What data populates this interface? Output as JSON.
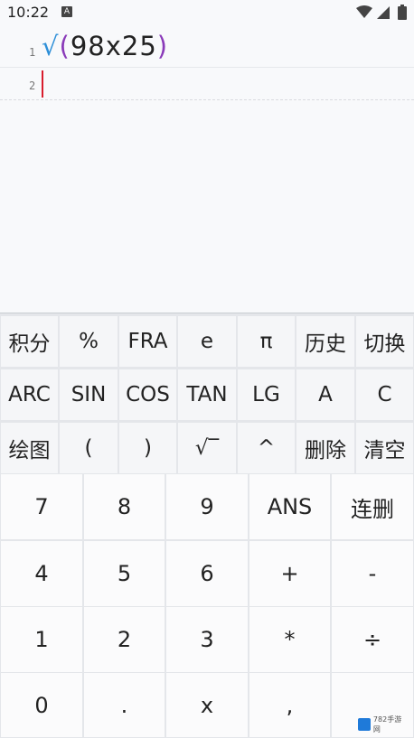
{
  "status_bar": {
    "time": "10:22",
    "notification_icon": "A",
    "icons": [
      "wifi-icon",
      "signal-icon",
      "battery-icon"
    ]
  },
  "editor": {
    "lines": [
      {
        "number": "1",
        "tokens": {
          "sqrt": "√",
          "open": "(",
          "body": "98x25",
          "close": ")"
        }
      },
      {
        "number": "2",
        "tokens": {}
      }
    ],
    "colors": {
      "sqrt": "#2d8fd8",
      "paren": "#8a3ab9",
      "cursor": "#d81c2c"
    }
  },
  "function_keys": [
    [
      "积分",
      "%",
      "FRA",
      "e",
      "π",
      "历史",
      "切换"
    ],
    [
      "ARC",
      "SIN",
      "COS",
      "TAN",
      "LG",
      "A",
      "C"
    ],
    [
      "绘图",
      "(",
      ")",
      "√‾",
      "^",
      "删除",
      "清空"
    ]
  ],
  "number_keys": [
    [
      "7",
      "8",
      "9",
      "ANS",
      "连删"
    ],
    [
      "4",
      "5",
      "6",
      "+",
      "-"
    ],
    [
      "1",
      "2",
      "3",
      "*",
      "÷"
    ],
    [
      "0",
      ".",
      "x",
      ",",
      ""
    ]
  ],
  "watermark": {
    "text": "782手游网"
  }
}
